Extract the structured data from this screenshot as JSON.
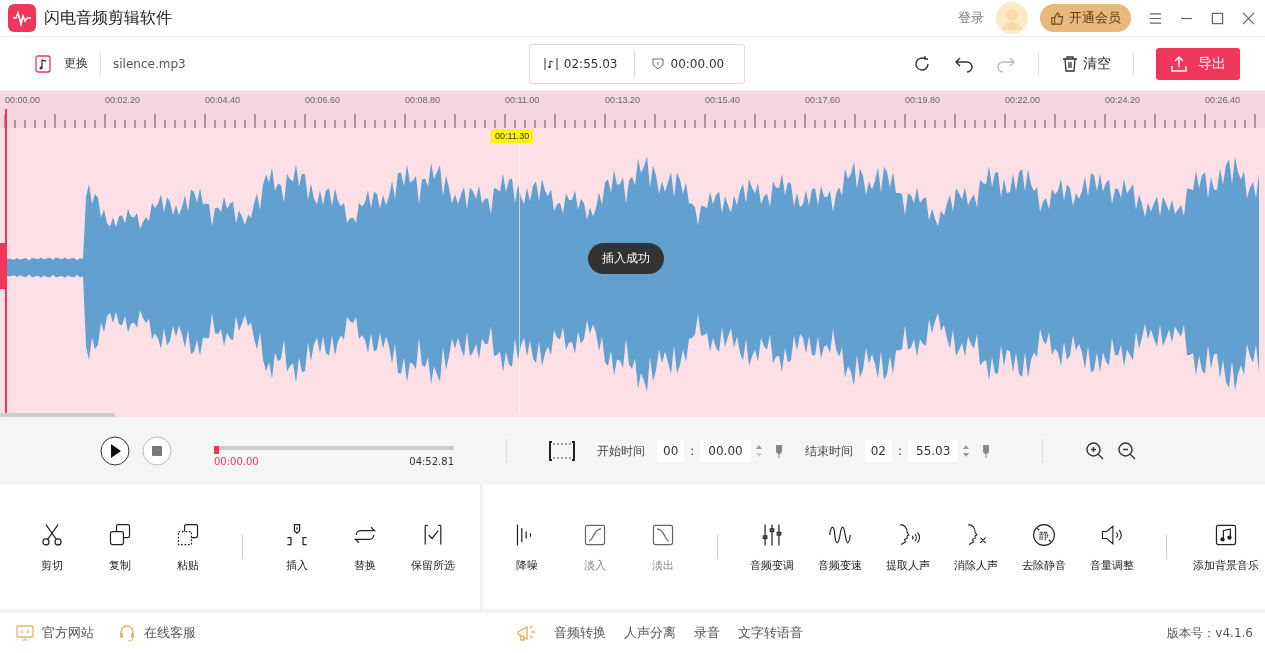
{
  "app": {
    "title": "闪电音频剪辑软件",
    "login": "登录",
    "vip": "开通会员"
  },
  "toolbar": {
    "replace": "更换",
    "file": "silence.mp3",
    "duration": "02:55.03",
    "selection": "00:00.00",
    "clear": "清空",
    "export": "导出"
  },
  "ruler": [
    "00:00.00",
    "00:02.20",
    "00:04.40",
    "00:06.60",
    "00:08.80",
    "00:11.00",
    "00:13.20",
    "00:15.40",
    "00:17.60",
    "00:19.80",
    "00:22.00",
    "00:24.20",
    "00:26.40"
  ],
  "cursor": {
    "time": "00:11.30"
  },
  "toast": "插入成功",
  "player": {
    "level": 0.02,
    "current": "00:00.00",
    "total": "04:52.81",
    "start_label": "开始时间",
    "start_min": "00",
    "separator": ":",
    "start_sec": "00.00",
    "end_label": "结束时间",
    "end_min": "02",
    "end_sec": "55.03"
  },
  "panels": [
    [
      [
        {
          "kind": "cut",
          "label": "剪切",
          "disabled": false
        },
        {
          "kind": "copy",
          "label": "复制",
          "disabled": false
        },
        {
          "kind": "paste",
          "label": "粘贴",
          "disabled": false
        }
      ],
      [
        {
          "kind": "insert",
          "label": "插入",
          "disabled": false
        },
        {
          "kind": "replace",
          "label": "替换",
          "disabled": false
        },
        {
          "kind": "keep",
          "label": "保留所选",
          "disabled": false
        }
      ]
    ],
    [
      [
        {
          "kind": "denoise",
          "label": "降噪",
          "disabled": false
        },
        {
          "kind": "fadein",
          "label": "淡入",
          "disabled": true
        },
        {
          "kind": "fadeout",
          "label": "淡出",
          "disabled": true
        }
      ],
      [
        {
          "kind": "pitch",
          "label": "音频变调",
          "disabled": false
        },
        {
          "kind": "speed",
          "label": "音频变速",
          "disabled": false
        },
        {
          "kind": "extract",
          "label": "提取人声",
          "disabled": false
        },
        {
          "kind": "remove",
          "label": "消除人声",
          "disabled": false
        },
        {
          "kind": "silence",
          "label": "去除静音",
          "glyph": "静",
          "disabled": false
        },
        {
          "kind": "volume",
          "label": "音量调整",
          "disabled": false
        }
      ],
      [
        {
          "kind": "bgm",
          "label": "添加背景音乐",
          "disabled": false
        }
      ]
    ]
  ],
  "footer": {
    "left": [
      {
        "kind": "web",
        "label": "官方网站"
      },
      {
        "kind": "service",
        "label": "在线客服"
      }
    ],
    "middle": [
      "音频转换",
      "人声分离",
      "录音",
      "文字转语音"
    ],
    "version": "版本号：v4.1.6"
  }
}
